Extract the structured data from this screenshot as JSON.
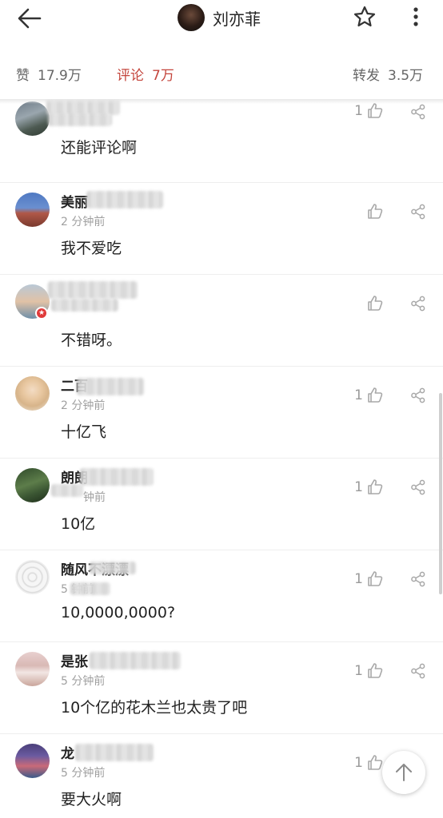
{
  "header": {
    "title": "刘亦菲",
    "back_icon": "arrow-left-icon",
    "star_icon": "star-outline-icon",
    "more_icon": "more-vertical-icon"
  },
  "tabs": [
    {
      "label": "赞",
      "count": "17.9万",
      "active": false
    },
    {
      "label": "评论",
      "count": "7万",
      "active": true
    },
    {
      "label": "转发",
      "count": "3.5万",
      "active": false
    }
  ],
  "colors": {
    "accent": "#c4453c",
    "muted": "#9a9a9a"
  },
  "comments": [
    {
      "name": "",
      "time": "",
      "text": "还能评论啊",
      "likes": "1"
    },
    {
      "name": "美丽",
      "time": "2 分钟前",
      "text": "我不爱吃",
      "likes": ""
    },
    {
      "name": "",
      "time": "",
      "text": "不错呀。",
      "likes": ""
    },
    {
      "name": "二百",
      "time": "2 分钟前",
      "text": "十亿飞",
      "likes": "1"
    },
    {
      "name": "朗朗",
      "time": "钟前",
      "text": "10亿",
      "likes": "1"
    },
    {
      "name": "随风不漂漂",
      "time": "5 钟前",
      "text": "10,0000,0000?",
      "likes": "1"
    },
    {
      "name": "是张",
      "time": "5 分钟前",
      "text": "10个亿的花木兰也太贵了吧",
      "likes": "1"
    },
    {
      "name": "龙",
      "time": "5 分钟前",
      "text": "要大火啊",
      "likes": "1"
    }
  ]
}
